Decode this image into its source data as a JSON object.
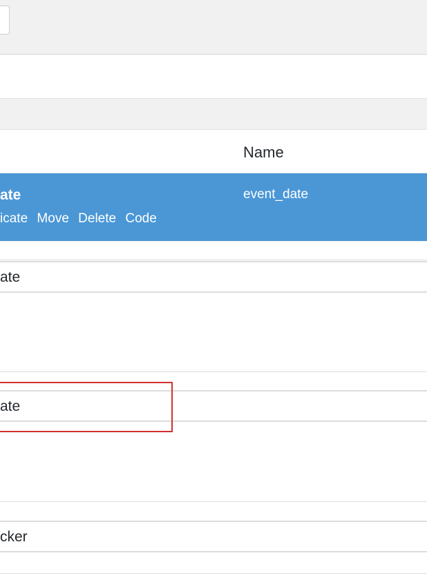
{
  "table": {
    "column_name_header": "Name"
  },
  "field": {
    "label_partial": "ate",
    "name": "event_date",
    "actions": [
      {
        "label": "icate"
      },
      {
        "label": "Move"
      },
      {
        "label": "Delete"
      },
      {
        "label": "Code"
      }
    ]
  },
  "settings": {
    "inputs": [
      {
        "value": "ate"
      },
      {
        "value": "ate"
      },
      {
        "value": "cker"
      }
    ]
  },
  "colors": {
    "accent": "#4b97d6",
    "highlight": "#d32f2f"
  }
}
